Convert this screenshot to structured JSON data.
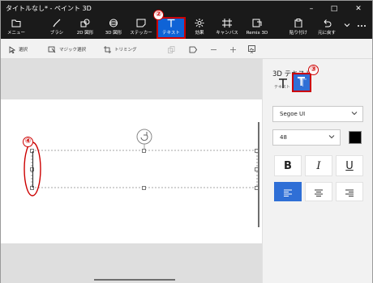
{
  "window": {
    "title": "タイトルなし* - ペイント 3D",
    "controls": [
      "minimize",
      "maximize",
      "close"
    ]
  },
  "ribbon": {
    "items": [
      {
        "label": "メニュー",
        "icon": "folder-icon"
      },
      {
        "label": "ブラシ",
        "icon": "brush-icon"
      },
      {
        "label": "2D 図形",
        "icon": "2d-shapes-icon"
      },
      {
        "label": "3D 図形",
        "icon": "3d-shapes-icon"
      },
      {
        "label": "ステッカー",
        "icon": "sticker-icon"
      },
      {
        "label": "テキスト",
        "icon": "text-icon",
        "active": true
      },
      {
        "label": "効果",
        "icon": "effects-icon"
      },
      {
        "label": "キャンバス",
        "icon": "canvas-icon"
      },
      {
        "label": "Remix 3D",
        "icon": "remix-3d-icon"
      },
      {
        "label": "貼り付け",
        "icon": "paste-icon"
      },
      {
        "label": "元に戻す",
        "icon": "undo-icon"
      },
      {
        "label": "",
        "icon": "chevron-down-icon"
      },
      {
        "label": "",
        "icon": "more-icon"
      }
    ]
  },
  "toolbar": {
    "select_label": "選択",
    "magic_select_label": "マジック選択",
    "crop_label": "トリミング"
  },
  "panel": {
    "title": "3D テキスト",
    "text_section_label": "テキスト",
    "font_family": "Segoe UI",
    "font_size": "48",
    "text_color": "#000000",
    "bold_label": "B",
    "italic_label": "I",
    "underline_label": "U"
  },
  "callouts": {
    "c2": "②",
    "c3": "③",
    "c4": "④"
  },
  "colors": {
    "accent": "#0f63d6",
    "callout": "#cc0000"
  }
}
